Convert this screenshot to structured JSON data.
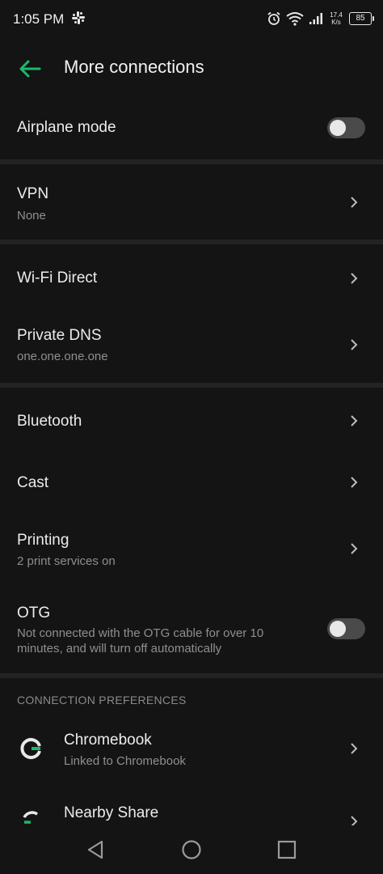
{
  "status_bar": {
    "time": "1:05 PM",
    "net_speed_value": "17.4",
    "net_speed_unit": "K/s",
    "battery": "85"
  },
  "app_bar": {
    "title": "More connections",
    "accent_color": "#1fb86a"
  },
  "settings": {
    "airplane_mode": {
      "title": "Airplane mode",
      "enabled": false
    },
    "vpn": {
      "title": "VPN",
      "subtitle": "None"
    },
    "wifi_direct": {
      "title": "Wi-Fi Direct"
    },
    "private_dns": {
      "title": "Private DNS",
      "subtitle": "one.one.one.one"
    },
    "bluetooth": {
      "title": "Bluetooth"
    },
    "cast": {
      "title": "Cast"
    },
    "printing": {
      "title": "Printing",
      "subtitle": "2 print services on"
    },
    "otg": {
      "title": "OTG",
      "subtitle": "Not connected with the OTG cable for over 10 minutes, and will turn off automatically",
      "enabled": false
    }
  },
  "connection_preferences": {
    "header": "CONNECTION PREFERENCES",
    "chromebook": {
      "title": "Chromebook",
      "subtitle": "Linked to Chromebook",
      "icon": "google-g-icon"
    },
    "nearby_share": {
      "title": "Nearby Share",
      "icon": "nearby-share-icon"
    }
  }
}
